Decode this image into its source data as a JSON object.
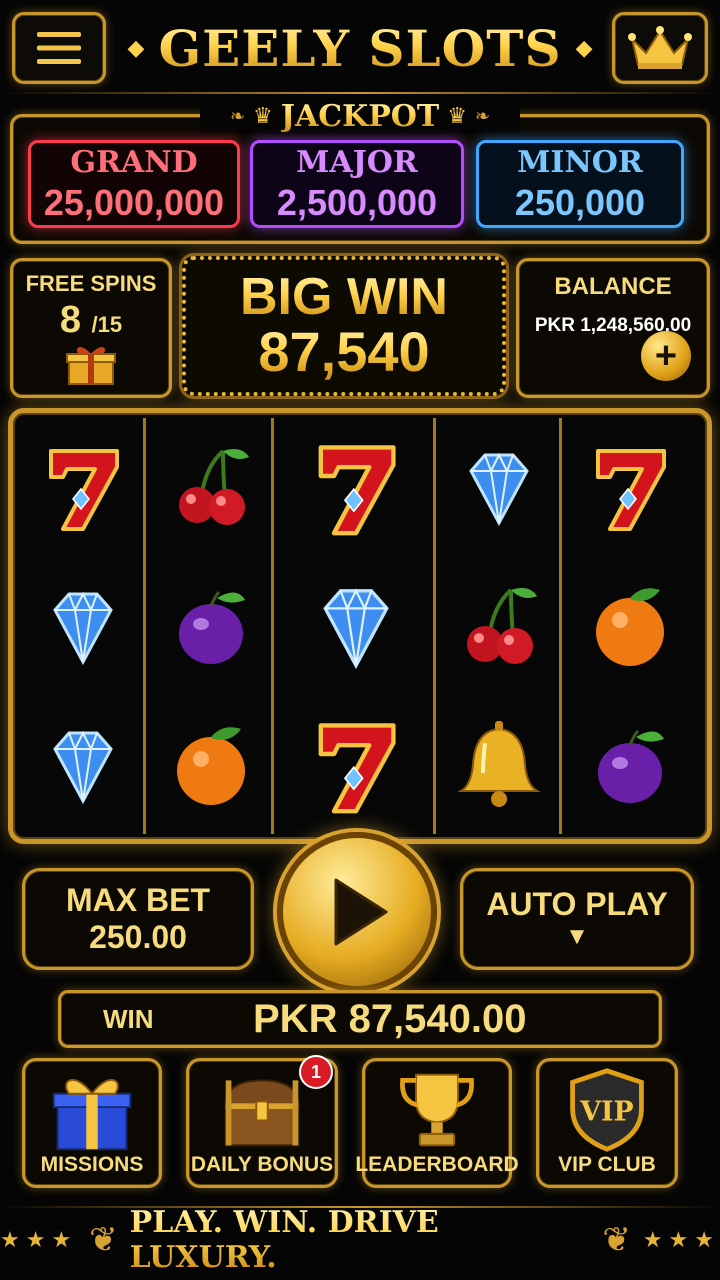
{
  "header": {
    "title": "GEELY SLOTS",
    "menu_icon": "hamburger-menu-icon",
    "crown_icon": "crown-icon"
  },
  "jackpot": {
    "label": "JACKPOT",
    "grand": {
      "name": "GRAND",
      "value": "25,000,000",
      "color": "#ff3b4b"
    },
    "major": {
      "name": "MAJOR",
      "value": "2,500,000",
      "color": "#b44dff"
    },
    "minor": {
      "name": "MINOR",
      "value": "250,000",
      "color": "#3fa7ff"
    }
  },
  "free_spins": {
    "label": "FREE SPINS",
    "count": "8",
    "total": "/15"
  },
  "big_win": {
    "label": "BIG WIN",
    "amount": "87,540"
  },
  "balance": {
    "label": "BALANCE",
    "value": "PKR 1,248,560.00"
  },
  "reels": [
    [
      "seven",
      "diamond",
      "diamond"
    ],
    [
      "cherry",
      "plum",
      "orange"
    ],
    [
      "seven",
      "diamond",
      "seven"
    ],
    [
      "diamond",
      "cherry",
      "bell"
    ],
    [
      "seven",
      "orange",
      "plum"
    ]
  ],
  "controls": {
    "max_bet_label": "MAX BET",
    "max_bet_value": "250.00",
    "auto_play_label": "AUTO PLAY",
    "auto_play_arrow": "▼"
  },
  "win": {
    "label": "WIN",
    "value": "PKR 87,540.00"
  },
  "nav": [
    {
      "label": "MISSIONS",
      "icon": "gift-box-icon"
    },
    {
      "label": "DAILY BONUS",
      "icon": "treasure-chest-icon",
      "badge": "1"
    },
    {
      "label": "LEADERBOARD",
      "icon": "trophy-icon"
    },
    {
      "label": "VIP CLUB",
      "icon": "vip-shield-icon",
      "shield_text": "VIP"
    }
  ],
  "footer": {
    "tagline": "PLAY. WIN. DRIVE LUXURY."
  },
  "colors": {
    "gold": "#c9962a",
    "background": "#050505",
    "accent_red": "#d81b25"
  }
}
